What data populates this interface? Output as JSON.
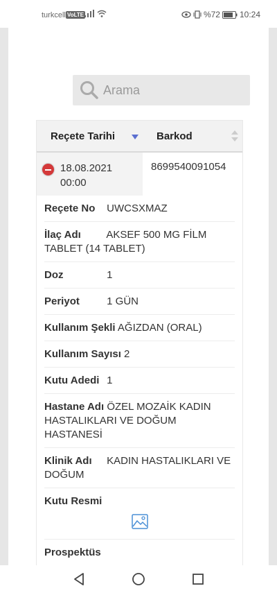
{
  "status_bar": {
    "carrier": "turkcell",
    "volte": "VoLTE",
    "battery": "%72",
    "time": "10:24"
  },
  "search": {
    "placeholder": "Arama"
  },
  "table": {
    "headers": [
      "Reçete Tarihi",
      "Barkod"
    ],
    "row": {
      "date": "18.08.2021 00:00",
      "barcode": "8699540091054"
    }
  },
  "details": [
    {
      "label": "Reçete No",
      "value": "UWCSXMAZ"
    },
    {
      "label": "İlaç Adı",
      "value": "AKSEF 500 MG FİLM TABLET (14 TABLET)"
    },
    {
      "label": "Doz",
      "value": "1"
    },
    {
      "label": "Periyot",
      "value": "1 GÜN"
    },
    {
      "label": "Kullanım Şekli",
      "value": "AĞIZDAN (ORAL)"
    },
    {
      "label": "Kullanım Sayısı",
      "value": "2"
    },
    {
      "label": "Kutu Adedi",
      "value": "1"
    },
    {
      "label": "Hastane Adı",
      "value": "ÖZEL MOZAİK KADIN HASTALIKLARI VE DOĞUM HASTANESİ"
    },
    {
      "label": "Klinik Adı",
      "value": "KADIN HASTALIKLARI VE DOĞUM"
    },
    {
      "label": "Kutu Resmi",
      "value": ""
    },
    {
      "label": "Prospektüs",
      "value": ""
    }
  ],
  "colors": {
    "remove_button": "#d4393a",
    "sort_arrow": "#5b6fd0",
    "icon_blue": "#4a8fd6"
  }
}
